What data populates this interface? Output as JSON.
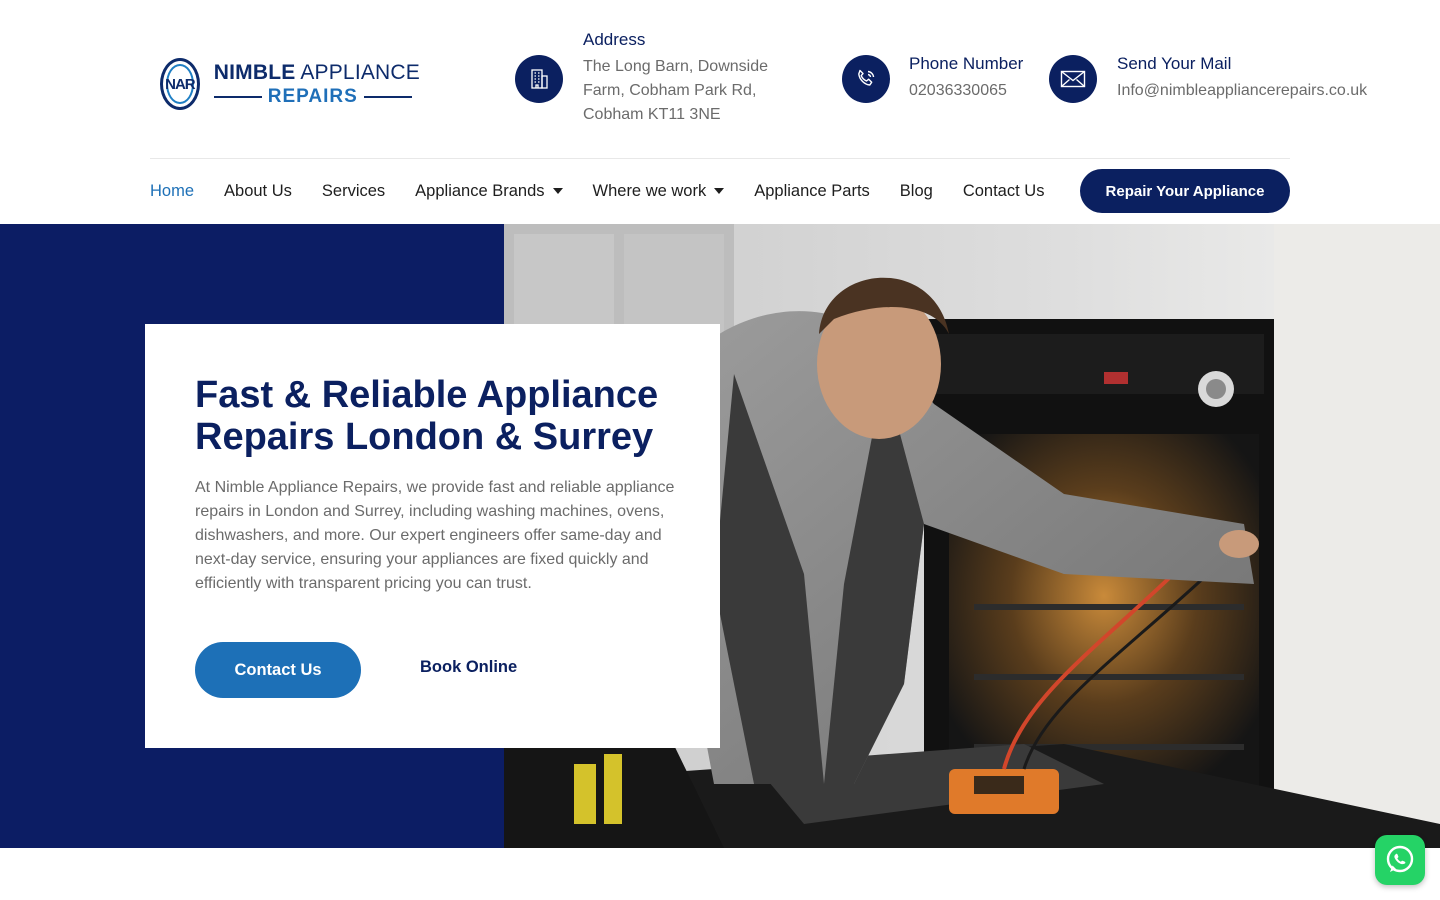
{
  "brand": {
    "badge": "NAR",
    "name_bold": "NIMBLE",
    "name_rest": " APPLIANCE",
    "name_sub": "REPAIRS"
  },
  "contact": {
    "address": {
      "title": "Address",
      "lines": [
        "The Long Barn, Downside",
        "Farm, Cobham Park Rd,",
        "Cobham KT11 3NE"
      ],
      "icon": "building-icon"
    },
    "phone": {
      "title": "Phone Number",
      "value": "02036330065",
      "icon": "phone-icon"
    },
    "mail": {
      "title": "Send Your Mail",
      "value": "Info@nimbleappliancerepairs.co.uk",
      "icon": "envelope-icon"
    }
  },
  "nav": {
    "items": [
      {
        "label": "Home"
      },
      {
        "label": "About Us"
      },
      {
        "label": "Services"
      },
      {
        "label": "Appliance Brands"
      },
      {
        "label": "Where we work"
      },
      {
        "label": "Appliance Parts"
      },
      {
        "label": "Blog"
      },
      {
        "label": "Contact Us"
      }
    ],
    "cta_label": "Repair Your Appliance"
  },
  "hero": {
    "title": "Fast & Reliable Appliance Repairs London & Surrey",
    "description": "At Nimble Appliance Repairs, we provide fast and reliable appliance repairs in London and Surrey, including washing machines, ovens, dishwashers, and more. Our expert engineers offer same-day and next-day service, ensuring your appliances are fixed quickly and efficiently with transparent pricing you can trust.",
    "primary_button": "Contact Us",
    "secondary_button": "Book Online",
    "photo_icon": "engineer-repairing-oven-photo"
  },
  "colors": {
    "navy": "#0b2060",
    "hero_navy": "#0c1d64",
    "accent_blue": "#1d70b7",
    "whatsapp_green": "#25d366"
  },
  "widgets": {
    "whatsapp_icon": "whatsapp-icon"
  }
}
